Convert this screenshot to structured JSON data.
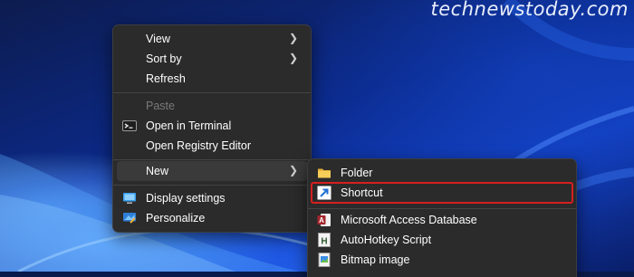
{
  "watermark": "technewstoday.com",
  "context_menu": {
    "items": [
      {
        "label": "View"
      },
      {
        "label": "Sort by"
      },
      {
        "label": "Refresh"
      },
      {
        "label": "Paste"
      },
      {
        "label": "Open in Terminal"
      },
      {
        "label": "Open Registry Editor"
      },
      {
        "label": "New"
      },
      {
        "label": "Display settings"
      },
      {
        "label": "Personalize"
      }
    ]
  },
  "new_submenu": {
    "items": [
      {
        "label": "Folder"
      },
      {
        "label": "Shortcut"
      },
      {
        "label": "Microsoft Access Database"
      },
      {
        "label": "AutoHotkey Script"
      },
      {
        "label": "Bitmap image"
      }
    ]
  },
  "colors": {
    "menu_background": "#2b2b2b",
    "highlight_border": "#d61f1f",
    "hover_background": "#3a3a3a"
  }
}
